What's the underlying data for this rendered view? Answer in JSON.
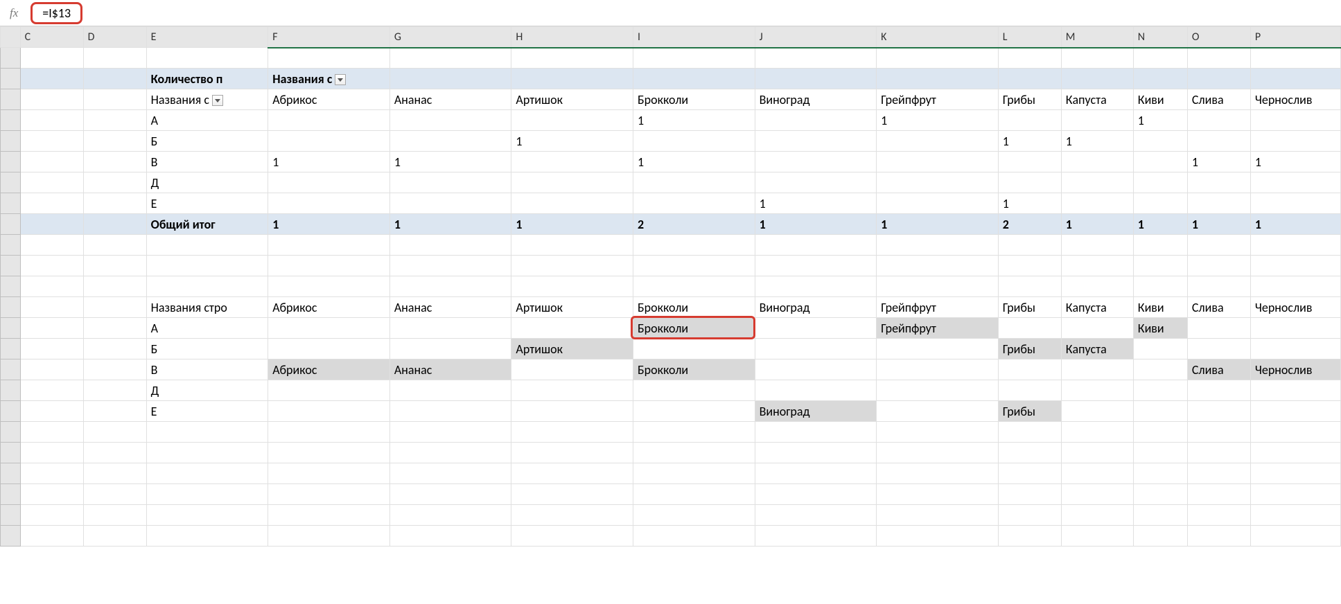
{
  "formula_bar": {
    "fx_label": "fx",
    "value": "=I$13"
  },
  "columns": [
    "C",
    "D",
    "E",
    "F",
    "G",
    "H",
    "I",
    "J",
    "K",
    "L",
    "M",
    "N",
    "O",
    "P"
  ],
  "selected_columns": [
    "F",
    "G",
    "H",
    "I",
    "J",
    "K",
    "L",
    "M",
    "N",
    "O",
    "P"
  ],
  "pivot_header": {
    "E": "Количество п",
    "F": "Названия с"
  },
  "pivot_col_row": {
    "E": "Названия с",
    "F": "Абрикос",
    "G": "Ананас",
    "H": "Артишок",
    "I": "Брокколи",
    "J": "Виноград",
    "K": "Грейпфрут",
    "L": "Грибы",
    "M": "Капуста",
    "N": "Киви",
    "O": "Слива",
    "P": "Чернослив"
  },
  "pivot_rows": [
    {
      "label": "А",
      "values": {
        "I": "1",
        "K": "1",
        "N": "1"
      }
    },
    {
      "label": "Б",
      "values": {
        "H": "1",
        "L": "1",
        "M": "1"
      }
    },
    {
      "label": "В",
      "values": {
        "F": "1",
        "G": "1",
        "I": "1",
        "O": "1",
        "P": "1"
      }
    },
    {
      "label": "Д",
      "values": {}
    },
    {
      "label": "Е",
      "values": {
        "J": "1",
        "L": "1"
      }
    }
  ],
  "pivot_total": {
    "label": "Общий итог",
    "values": {
      "F": "1",
      "G": "1",
      "H": "1",
      "I": "2",
      "J": "1",
      "K": "1",
      "L": "2",
      "M": "1",
      "N": "1",
      "O": "1",
      "P": "1"
    }
  },
  "lower_header": {
    "E": "Названия стро",
    "F": "Абрикос",
    "G": "Ананас",
    "H": "Артишок",
    "I": "Брокколи",
    "J": "Виноград",
    "K": "Грейпфрут",
    "L": "Грибы",
    "M": "Капуста",
    "N": "Киви",
    "O": "Слива",
    "P": "Чернослив"
  },
  "lower_rows": [
    {
      "label": "А",
      "cells": {
        "I": {
          "text": "Брокколи",
          "grey": true,
          "active": true
        },
        "K": {
          "text": "Грейпфрут",
          "grey": true
        },
        "N": {
          "text": "Киви",
          "grey": true
        }
      }
    },
    {
      "label": "Б",
      "cells": {
        "H": {
          "text": "Артишок",
          "grey": true
        },
        "L": {
          "text": "Грибы",
          "grey": true
        },
        "M": {
          "text": "Капуста",
          "grey": true
        }
      }
    },
    {
      "label": "В",
      "cells": {
        "F": {
          "text": "Абрикос",
          "grey": true
        },
        "G": {
          "text": "Ананас",
          "grey": true
        },
        "I": {
          "text": "Брокколи",
          "grey": true
        },
        "O": {
          "text": "Слива",
          "grey": true
        },
        "P": {
          "text": "Чернослив",
          "grey": true
        }
      }
    },
    {
      "label": "Д",
      "cells": {}
    },
    {
      "label": "Е",
      "cells": {
        "J": {
          "text": "Виноград",
          "grey": true
        },
        "L": {
          "text": "Грибы",
          "grey": true
        }
      }
    }
  ],
  "active_cell": {
    "col": "I",
    "row_index": 16
  }
}
